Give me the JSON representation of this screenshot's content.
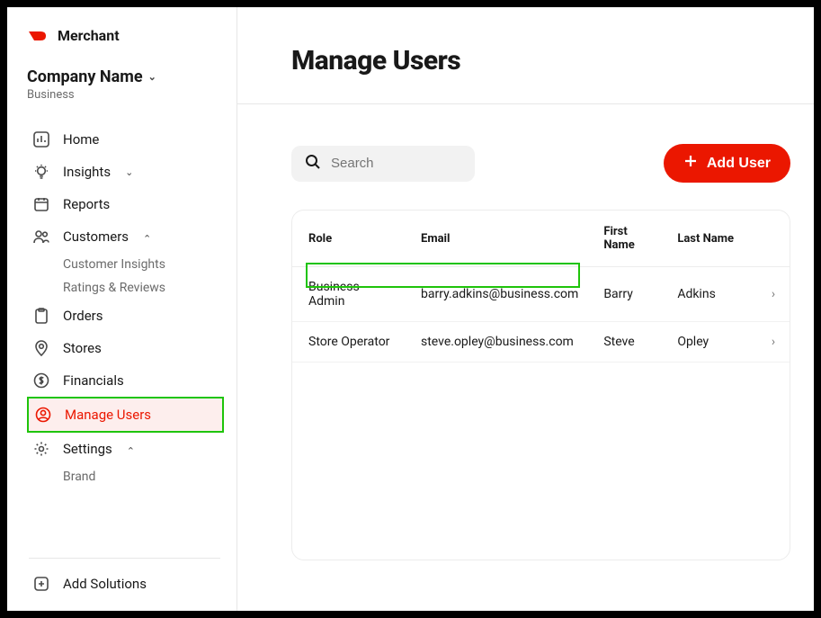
{
  "brand": {
    "label": "Merchant"
  },
  "company": {
    "name": "Company Name",
    "type": "Business"
  },
  "nav": {
    "home": "Home",
    "insights": "Insights",
    "reports": "Reports",
    "customers": "Customers",
    "customers_sub": {
      "insights": "Customer Insights",
      "ratings": "Ratings & Reviews"
    },
    "orders": "Orders",
    "stores": "Stores",
    "financials": "Financials",
    "manage_users": "Manage Users",
    "settings": "Settings",
    "settings_sub": {
      "brand": "Brand"
    },
    "add_solutions": "Add Solutions"
  },
  "header": {
    "title": "Manage Users"
  },
  "search": {
    "placeholder": "Search"
  },
  "add_user_btn": "Add User",
  "table": {
    "headers": {
      "role": "Role",
      "email": "Email",
      "first_name": "First Name",
      "last_name": "Last Name"
    },
    "rows": [
      {
        "role": "Business Admin",
        "email": "barry.adkins@business.com",
        "first_name": "Barry",
        "last_name": "Adkins",
        "highlighted": true
      },
      {
        "role": "Store Operator",
        "email": "steve.opley@business.com",
        "first_name": "Steve",
        "last_name": "Opley",
        "highlighted": false
      }
    ]
  }
}
